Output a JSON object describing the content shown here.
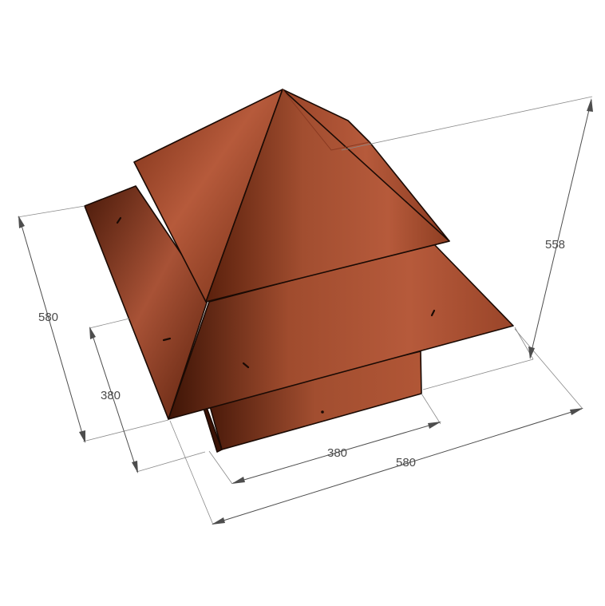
{
  "drawing": {
    "colors": {
      "copper_light": "#b65a3b",
      "copper_mid": "#9a4529",
      "copper_dark": "#4a1a0a",
      "edge": "#1a0a04",
      "dimension_line": "#4d4d4d"
    },
    "dimensions": {
      "height_total": "558",
      "cap_depth": "580",
      "base_depth": "380",
      "base_width": "380",
      "cap_width": "580"
    }
  }
}
